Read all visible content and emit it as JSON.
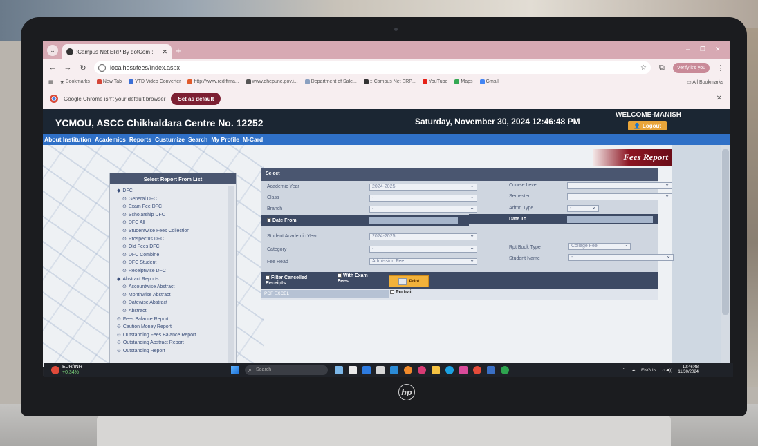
{
  "browser": {
    "tab_title": ":Campus Net ERP By dotCom :",
    "url": "localhost/fees/Index.aspx",
    "verify_label": "Verify it's you",
    "bookmarks": [
      "Bookmarks",
      "New Tab",
      "YTD Video Converter",
      "http://www.rediffma...",
      "www.dhepune.gov.i...",
      "Department of Sale...",
      ":: Campus Net ERP...",
      "YouTube",
      "Maps",
      "Gmail"
    ],
    "all_bookmarks": "All Bookmarks",
    "infobar_text": "Google Chrome isn't your default browser",
    "set_default_label": "Set as default"
  },
  "site": {
    "institution": "YCMOU, ASCC Chikhaldara Centre No. 12252",
    "datetime": "Saturday, November 30, 2024 12:46:48 PM",
    "welcome": "WELCOME-MANISH",
    "logout_label": "Logout",
    "nav": [
      "About Institution",
      "Academics",
      "Reports",
      "Custumize",
      "Search",
      "My Profile",
      "M-Card"
    ],
    "page_title": "Fees Report"
  },
  "report_list": {
    "header": "Select Report From List",
    "items": [
      {
        "label": "DFC",
        "level": 1,
        "bullet": "◆"
      },
      {
        "label": "General DFC",
        "level": 2,
        "bullet": "⊙"
      },
      {
        "label": "Exam Fee DFC",
        "level": 2,
        "bullet": "⊙"
      },
      {
        "label": "Scholarship DFC",
        "level": 2,
        "bullet": "⊙"
      },
      {
        "label": "DFC All",
        "level": 2,
        "bullet": "⊙"
      },
      {
        "label": "Studentwise Fees Collection",
        "level": 2,
        "bullet": "⊙"
      },
      {
        "label": "Prospectus DFC",
        "level": 2,
        "bullet": "⊙"
      },
      {
        "label": "Old Fees DFC",
        "level": 2,
        "bullet": "⊙"
      },
      {
        "label": "DFC Combine",
        "level": 2,
        "bullet": "⊙"
      },
      {
        "label": "DFC Student",
        "level": 2,
        "bullet": "⊙"
      },
      {
        "label": "Receiptwise DFC",
        "level": 2,
        "bullet": "⊙"
      },
      {
        "label": "Abstract Reports",
        "level": 1,
        "bullet": "◆"
      },
      {
        "label": "Accountwise Abstract",
        "level": 2,
        "bullet": "⊙"
      },
      {
        "label": "Monthwise Abstract",
        "level": 2,
        "bullet": "⊙"
      },
      {
        "label": "Datewise Abstract",
        "level": 2,
        "bullet": "⊙"
      },
      {
        "label": "Abstract",
        "level": 2,
        "bullet": "⊙"
      },
      {
        "label": "Fees Balance Report",
        "level": 1,
        "bullet": "⊙"
      },
      {
        "label": "Caution Money Report",
        "level": 1,
        "bullet": "⊙"
      },
      {
        "label": "Outstanding Fees Balance Report",
        "level": 1,
        "bullet": "⊙"
      },
      {
        "label": "Outstanding Abstract Report",
        "level": 1,
        "bullet": "⊙"
      },
      {
        "label": "Outstanding Report",
        "level": 1,
        "bullet": "⊙"
      }
    ]
  },
  "form": {
    "header": "Select",
    "academic_year_label": "Academic Year",
    "academic_year_value": "2024-2025",
    "class_label": "Class",
    "class_value": "-",
    "branch_label": "Branch",
    "branch_value": "-",
    "course_level_label": "Course Level",
    "course_level_value": "",
    "semester_label": "Semester",
    "semester_value": "",
    "admn_type_label": "Admn Type",
    "admn_type_value": "-",
    "date_from_label": "Date From",
    "date_to_label": "Date To",
    "student_ay_label": "Student Academic Year",
    "student_ay_value": "2024-2025",
    "category_label": "Category",
    "category_value": "-",
    "fee_head_label": "Fee Head",
    "fee_head_value": "Admission Fee",
    "rpt_book_type_label": "Rpt Book Type",
    "rpt_book_type_value": "College Fee",
    "student_name_label": "Student Name",
    "student_name_value": "-",
    "filter_cancelled_label": "Filter Cancelled Receipts",
    "with_exam_fees_label": "With Exam Fees",
    "print_label": "Print",
    "format_label": "PDF EXCEL",
    "portrait_label": "Portrait"
  },
  "taskbar": {
    "stock_name": "EUR/INR",
    "stock_change": "+0.34%",
    "search_placeholder": "Search",
    "lang": "ENG IN",
    "time": "12:46:48",
    "date": "11/30/2024"
  },
  "hardware": {
    "logo": "hp"
  }
}
